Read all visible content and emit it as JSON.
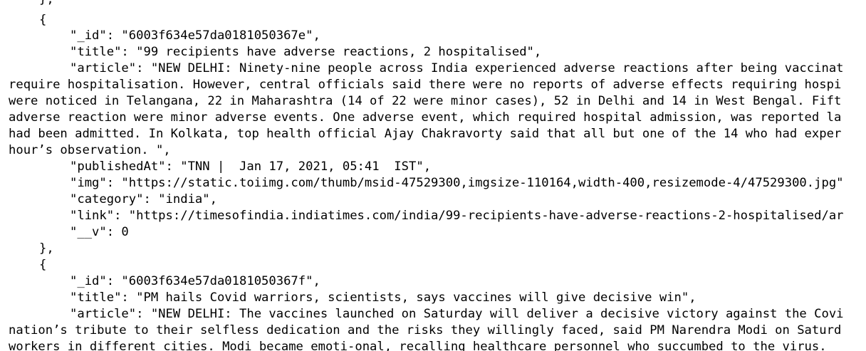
{
  "document": {
    "lines": [
      "},",
      "{",
      "\"_id\": \"6003f634e57da0181050367e\",",
      "\"title\": \"99 recipients have adverse reactions, 2 hospitalised\",",
      "\"article\": \"NEW DELHI: Ninety-nine people across India experienced adverse reactions after being vaccinat",
      "require hospitalisation. However, central officials said there were no reports of adverse effects requiring hospi",
      "were noticed in Telangana, 22 in Maharashtra (14 of 22 were minor cases), 52 in Delhi and 14 in West Bengal. Fift",
      "adverse reaction were minor adverse events. One adverse event, which required hospital admission, was reported la",
      "had been admitted. In Kolkata, top health official Ajay Chakravorty said that all but one of the 14 who had exper",
      "hour’s observation. \",",
      "\"publishedAt\": \"TNN |  Jan 17, 2021, 05:41  IST\",",
      "\"img\": \"https://static.toiimg.com/thumb/msid-47529300,imgsize-110164,width-400,resizemode-4/47529300.jpg\"",
      "\"category\": \"india\",",
      "\"link\": \"https://timesofindia.indiatimes.com/india/99-recipients-have-adverse-reactions-2-hospitalised/ar",
      "\"__v\": 0",
      "},",
      "{",
      "\"_id\": \"6003f634e57da0181050367f\",",
      "\"title\": \"PM hails Covid warriors, scientists, says vaccines will give decisive win\",",
      "\"article\": \"NEW DELHI: The vaccines launched on Saturday will deliver a decisive victory against the Covi",
      "nation’s tribute to their selfless dedication and the risks they willingly faced, said PM Narendra Modi on Saturd",
      "workers in different cities. Modi became emoti-onal, recalling healthcare personnel who succumbed to the virus. "
    ]
  }
}
